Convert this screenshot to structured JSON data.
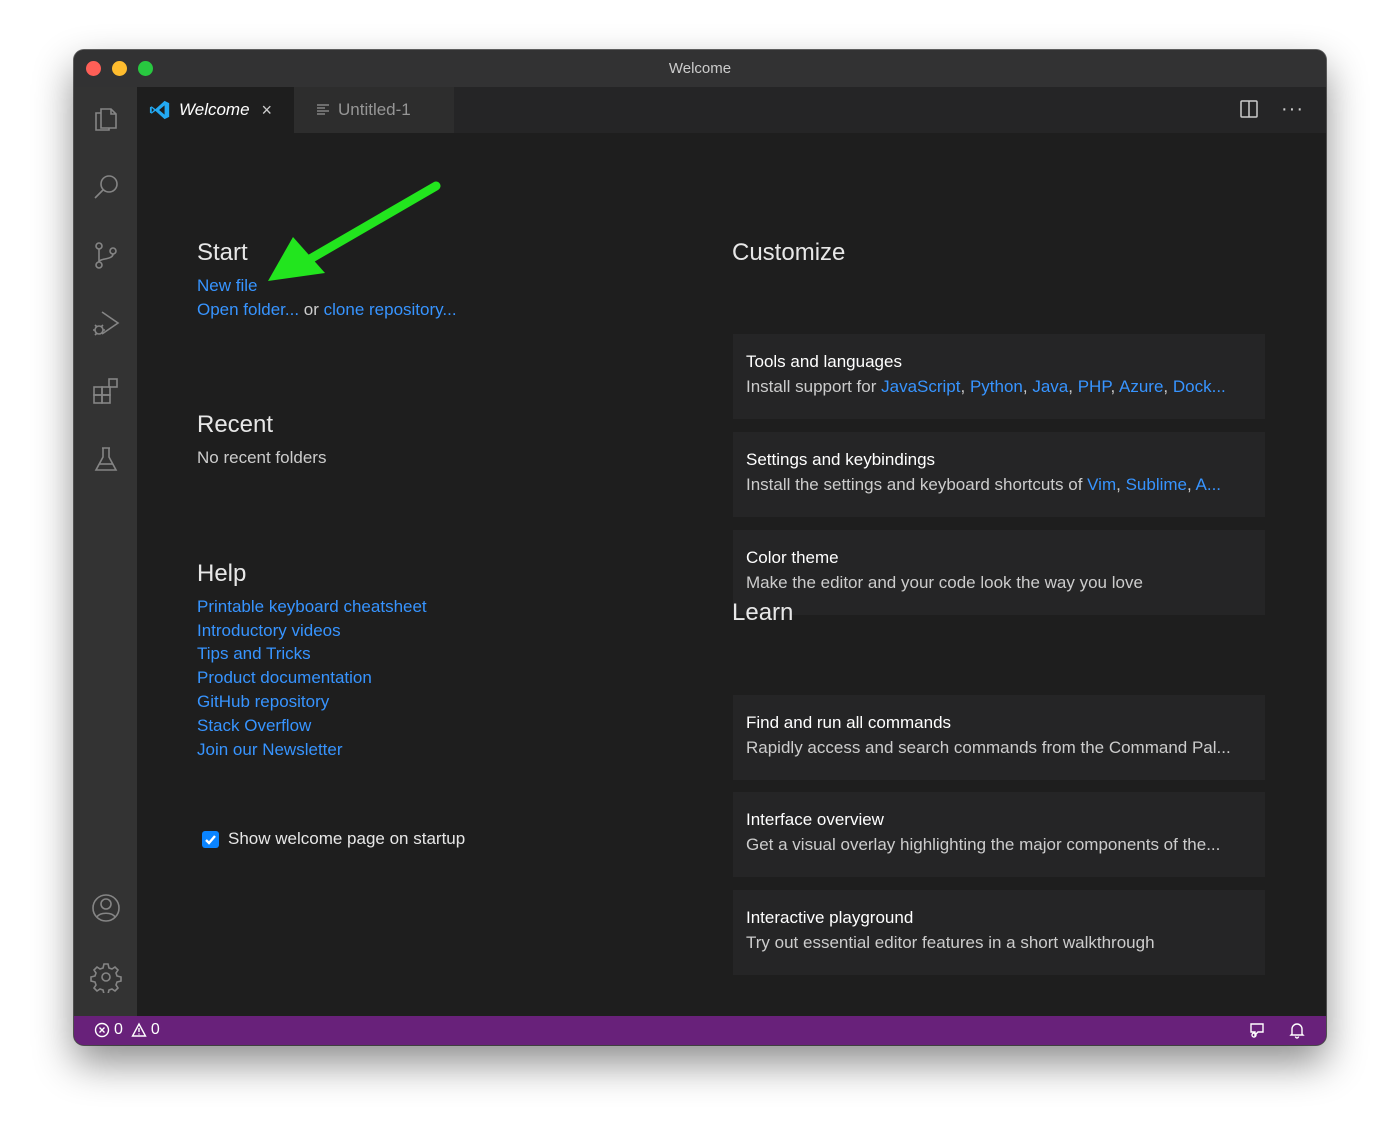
{
  "window": {
    "title": "Welcome"
  },
  "tabs": [
    {
      "label": "Welcome",
      "close": "×"
    },
    {
      "label": "Untitled-1"
    }
  ],
  "tab_actions": {
    "more": "···"
  },
  "activity": [
    "explorer-icon",
    "search-icon",
    "source-control-icon",
    "run-debug-icon",
    "extensions-icon",
    "testing-icon",
    "account-icon",
    "settings-gear-icon"
  ],
  "start": {
    "heading": "Start",
    "new_file": "New file",
    "open_folder": "Open folder...",
    "or": " or ",
    "clone_repo": "clone repository..."
  },
  "recent": {
    "heading": "Recent",
    "empty": "No recent folders"
  },
  "help": {
    "heading": "Help",
    "links": [
      "Printable keyboard cheatsheet",
      "Introductory videos",
      "Tips and Tricks",
      "Product documentation",
      "GitHub repository",
      "Stack Overflow",
      "Join our Newsletter"
    ]
  },
  "show_on_startup": {
    "label": "Show welcome page on startup",
    "checked": true
  },
  "customize": {
    "heading": "Customize",
    "tools": {
      "title": "Tools and languages",
      "prefix": "Install support for ",
      "langs": [
        "JavaScript",
        "Python",
        "Java",
        "PHP",
        "Azure",
        "Dock..."
      ]
    },
    "settings": {
      "title": "Settings and keybindings",
      "prefix": "Install the settings and keyboard shortcuts of ",
      "editors": [
        "Vim",
        "Sublime",
        "A..."
      ]
    },
    "theme": {
      "title": "Color theme",
      "desc": "Make the editor and your code look the way you love"
    }
  },
  "learn": {
    "heading": "Learn",
    "cards": [
      {
        "title": "Find and run all commands",
        "desc": "Rapidly access and search commands from the Command Pal..."
      },
      {
        "title": "Interface overview",
        "desc": "Get a visual overlay highlighting the major components of the..."
      },
      {
        "title": "Interactive playground",
        "desc": "Try out essential editor features in a short walkthrough"
      }
    ]
  },
  "status": {
    "errors": "0",
    "warnings": "0"
  },
  "colors": {
    "link": "#3794ff",
    "statusbar": "#68217a",
    "arrow": "#22e51e"
  }
}
